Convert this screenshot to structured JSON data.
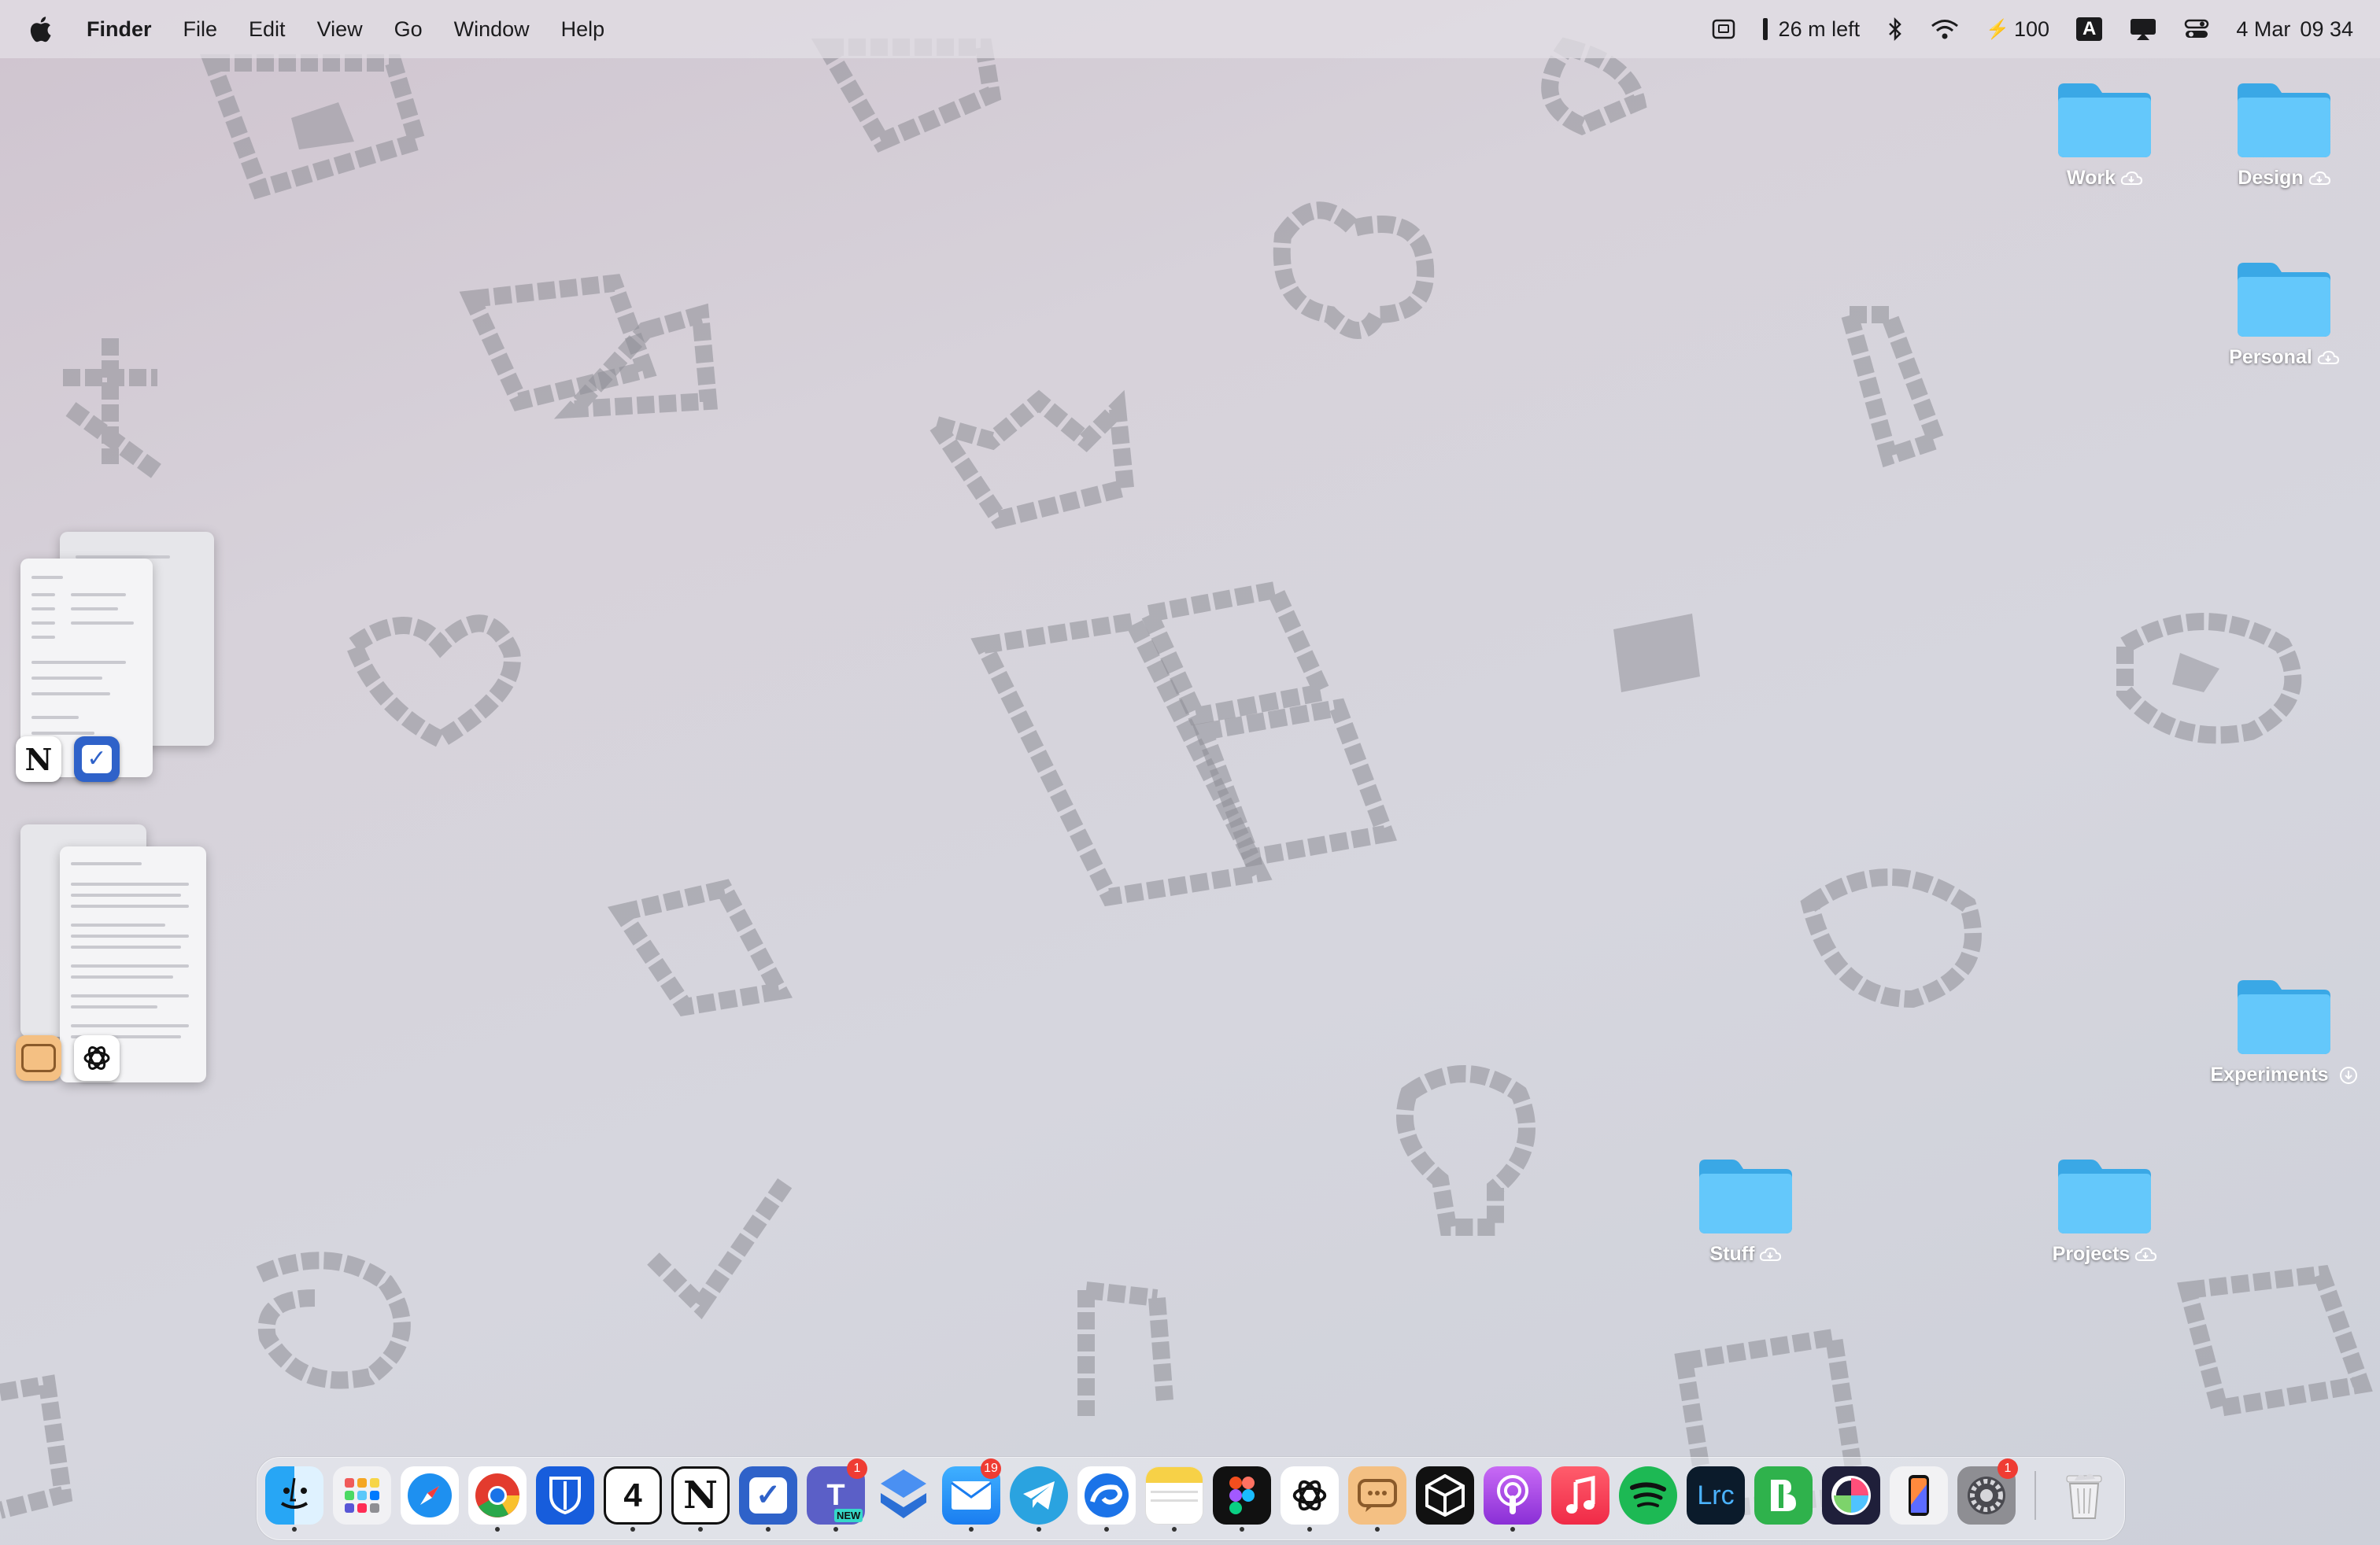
{
  "menubar": {
    "app_name": "Finder",
    "menus": [
      "File",
      "Edit",
      "View",
      "Go",
      "Window",
      "Help"
    ],
    "battery_time": "26 m left",
    "battery_level": "100",
    "input_source": "A",
    "date": "4 Mar",
    "time": "09 34"
  },
  "desktop": {
    "folders": [
      {
        "label": "Work",
        "status": "cloud"
      },
      {
        "label": "Design",
        "status": "cloud"
      },
      {
        "label": "Personal",
        "status": "cloud"
      },
      {
        "label": "Experiments",
        "status": "downloading"
      },
      {
        "label": "Stuff",
        "status": "cloud"
      },
      {
        "label": "Projects",
        "status": "cloud"
      }
    ],
    "folder_color": "#5ec8fa"
  },
  "stage_manager": {
    "groups": [
      {
        "apps": [
          "notion-icon",
          "todo-check-icon"
        ]
      },
      {
        "apps": [
          "chat-bubble-icon",
          "chatgpt-icon"
        ]
      }
    ]
  },
  "dock": {
    "apps": [
      {
        "name": "Finder",
        "icon": "finder-icon",
        "running": true
      },
      {
        "name": "Launchpad",
        "icon": "launchpad-icon",
        "running": false
      },
      {
        "name": "Safari",
        "icon": "safari-icon",
        "running": false
      },
      {
        "name": "Chrome",
        "icon": "chrome-icon",
        "running": true
      },
      {
        "name": "Bitwarden",
        "icon": "bitwarden-icon",
        "running": false
      },
      {
        "name": "Calendar",
        "icon": "calendar-icon",
        "label": "4",
        "running": true
      },
      {
        "name": "Notion",
        "icon": "notion-icon",
        "label": "N",
        "running": true
      },
      {
        "name": "Todo",
        "icon": "todo-check-icon",
        "running": true
      },
      {
        "name": "Teams",
        "icon": "teams-icon",
        "label": "T",
        "badge": "1",
        "tag": "NEW",
        "running": true
      },
      {
        "name": "Linear",
        "icon": "linear-icon",
        "running": false
      },
      {
        "name": "Mail",
        "icon": "mail-icon",
        "badge": "19",
        "running": true
      },
      {
        "name": "Telegram",
        "icon": "telegram-icon",
        "running": true
      },
      {
        "name": "Edge",
        "icon": "edge-icon",
        "running": true
      },
      {
        "name": "Notes",
        "icon": "notes-icon",
        "running": true
      },
      {
        "name": "Figma",
        "icon": "figma-icon",
        "running": true
      },
      {
        "name": "ChatGPT",
        "icon": "chatgpt-icon",
        "running": true
      },
      {
        "name": "Messages",
        "icon": "chat-bubble-icon",
        "running": true
      },
      {
        "name": "Unity",
        "icon": "unity-icon",
        "running": false
      },
      {
        "name": "Podcasts",
        "icon": "podcasts-icon",
        "running": true
      },
      {
        "name": "Music",
        "icon": "music-icon",
        "running": false
      },
      {
        "name": "Spotify",
        "icon": "spotify-icon",
        "running": false
      },
      {
        "name": "Lightroom Classic",
        "icon": "lightroom-icon",
        "label": "Lrc",
        "running": false
      },
      {
        "name": "Bear",
        "icon": "bear-icon",
        "running": false
      },
      {
        "name": "Pixelmator",
        "icon": "pixelmator-icon",
        "running": false
      },
      {
        "name": "iPhone Mirroring",
        "icon": "iphone-icon",
        "running": false
      },
      {
        "name": "System Settings",
        "icon": "gear-icon",
        "badge": "1",
        "running": false
      },
      {
        "name": "Trash",
        "icon": "trash-icon",
        "running": false
      }
    ]
  },
  "colors": {
    "badge": "#ef3c33",
    "folder": "#5ec8fa"
  }
}
